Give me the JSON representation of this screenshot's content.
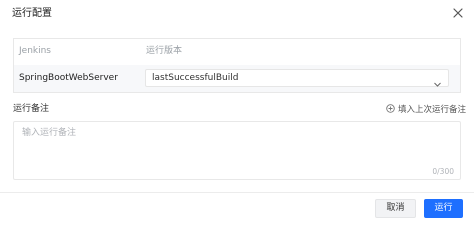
{
  "dialog": {
    "title": "运行配置",
    "close_icon": "close-icon"
  },
  "table": {
    "headers": [
      "Jenkins",
      "运行版本"
    ],
    "rows": [
      {
        "name": "SpringBootWebServer",
        "version": "lastSuccessfulBuild"
      }
    ]
  },
  "remark": {
    "label": "运行备注",
    "fill_last_label": "填入上次运行备注",
    "placeholder": "输入运行备注",
    "counter": "0/300"
  },
  "footer": {
    "cancel_label": "取消",
    "run_label": "运行"
  },
  "colors": {
    "primary": "#1e6fff",
    "row_bg": "#f7f8fa"
  }
}
